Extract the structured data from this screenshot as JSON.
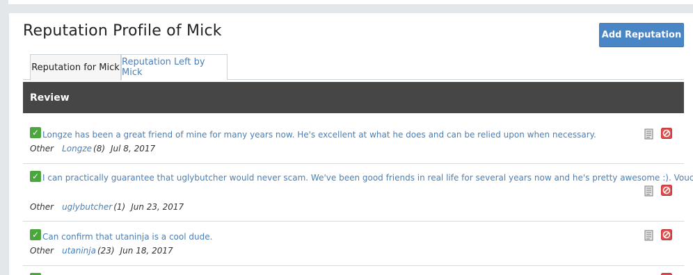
{
  "page": {
    "title": "Reputation Profile of Mick",
    "add_button": "Add Reputation"
  },
  "tabs": [
    {
      "label": "Reputation for Mick",
      "active": true
    },
    {
      "label": "Reputation Left by Mick",
      "active": false
    }
  ],
  "review_header": "Review",
  "reviews": [
    {
      "status": "positive",
      "message": "Longze has been a great friend of mine for many years now. He's excellent at what he does and can be relied upon when necessary.",
      "type": "Other",
      "user": "Longze",
      "count": "(8)",
      "date": "Jul 8, 2017"
    },
    {
      "status": "positive",
      "message": "I can practically guarantee that uglybutcher would never scam. We've been good friends in real life for several years now and he's pretty awesome :). Vouch.",
      "type": "Other",
      "user": "uglybutcher",
      "count": "(1)",
      "date": "Jun 23, 2017"
    },
    {
      "status": "positive",
      "message": "Can confirm that utaninja is a cool dude.",
      "type": "Other",
      "user": "utaninja",
      "count": "(23)",
      "date": "Jun 18, 2017"
    }
  ],
  "icons": {
    "check": "check-icon",
    "report": "report-icon",
    "delete": "delete-icon"
  },
  "colors": {
    "accent": "#4a86c5",
    "link": "#4a7fb5",
    "header_bg": "#464646",
    "positive": "#4aa63d",
    "delete": "#e04b4b"
  }
}
